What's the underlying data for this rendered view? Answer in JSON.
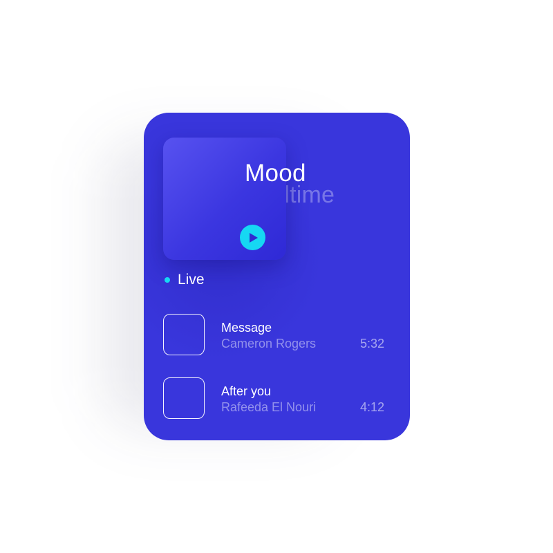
{
  "player": {
    "title": "Mood",
    "ghost_title": "Bedtime",
    "status": "Live",
    "colors": {
      "card": "#3936dc",
      "accent": "#16d7f3",
      "text": "#ffffff"
    },
    "play_icon": "play-icon"
  },
  "tracks": [
    {
      "title": "Message",
      "artist": "Cameron Rogers",
      "duration": "5:32"
    },
    {
      "title": "After you",
      "artist": "Rafeeda El Nouri",
      "duration": "4:12"
    }
  ]
}
